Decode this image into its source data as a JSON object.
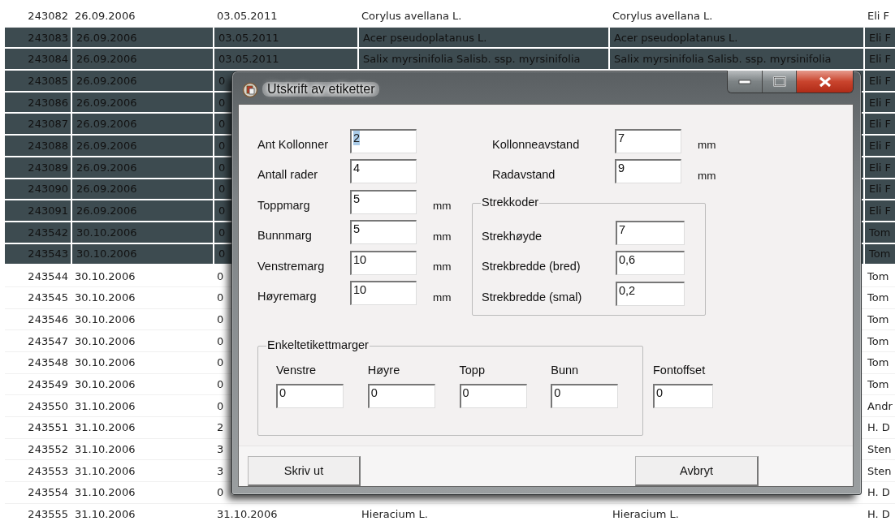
{
  "table": {
    "rows": [
      {
        "selected": false,
        "column_1": "243082",
        "column_2": "26.09.2006",
        "column_3": "03.05.2011",
        "column_4": "Corylus avellana L.",
        "column_5": "Corylus avellana L.",
        "column_6": "Eli F"
      },
      {
        "selected": true,
        "column_1": "243083",
        "column_2": "26.09.2006",
        "column_3": "03.05.2011",
        "column_4": "Acer pseudoplatanus L.",
        "column_5": "Acer pseudoplatanus L.",
        "column_6": "Eli F"
      },
      {
        "selected": true,
        "column_1": "243084",
        "column_2": "26.09.2006",
        "column_3": "03.05.2011",
        "column_4": "Salix myrsinifolia Salisb. ssp. myrsinifolia",
        "column_5": "Salix myrsinifolia Salisb. ssp. myrsinifolia",
        "column_6": "Eli F"
      },
      {
        "selected": true,
        "column_1": "243085",
        "column_2": "26.09.2006",
        "column_3": "0",
        "column_6": "Eli F"
      },
      {
        "selected": true,
        "column_1": "243086",
        "column_2": "26.09.2006",
        "column_3": "0",
        "column_6": "Eli F"
      },
      {
        "selected": true,
        "column_1": "243087",
        "column_2": "26.09.2006",
        "column_3": "0",
        "column_6": "Eli F"
      },
      {
        "selected": true,
        "column_1": "243088",
        "column_2": "26.09.2006",
        "column_3": "0",
        "column_6": "Eli F"
      },
      {
        "selected": true,
        "column_1": "243089",
        "column_2": "26.09.2006",
        "column_3": "0",
        "column_6": "Eli F"
      },
      {
        "selected": true,
        "column_1": "243090",
        "column_2": "26.09.2006",
        "column_3": "0",
        "column_6": "Eli F"
      },
      {
        "selected": true,
        "column_1": "243091",
        "column_2": "26.09.2006",
        "column_3": "0",
        "column_6": "Eli F"
      },
      {
        "selected": true,
        "column_1": "243542",
        "column_2": "30.10.2006",
        "column_3": "0",
        "column_6": "Tom"
      },
      {
        "selected": true,
        "column_1": "243543",
        "column_2": "30.10.2006",
        "column_3": "0",
        "column_6": "Tom"
      },
      {
        "selected": false,
        "column_1": "243544",
        "column_2": "30.10.2006",
        "column_3": "0",
        "column_6": "Tom"
      },
      {
        "selected": false,
        "column_1": "243545",
        "column_2": "30.10.2006",
        "column_3": "0",
        "column_6": "Tom"
      },
      {
        "selected": false,
        "column_1": "243546",
        "column_2": "30.10.2006",
        "column_3": "0",
        "column_6": "Tom"
      },
      {
        "selected": false,
        "column_1": "243547",
        "column_2": "30.10.2006",
        "column_3": "0",
        "column_6": "Tom"
      },
      {
        "selected": false,
        "column_1": "243548",
        "column_2": "30.10.2006",
        "column_3": "0",
        "column_6": "Tom"
      },
      {
        "selected": false,
        "column_1": "243549",
        "column_2": "30.10.2006",
        "column_3": "0",
        "column_6": "Tom"
      },
      {
        "selected": false,
        "column_1": "243550",
        "column_2": "31.10.2006",
        "column_3": "0",
        "column_6": "Andr"
      },
      {
        "selected": false,
        "column_1": "243551",
        "column_2": "31.10.2006",
        "column_3": "2",
        "column_6": "H. D"
      },
      {
        "selected": false,
        "column_1": "243552",
        "column_2": "31.10.2006",
        "column_3": "3",
        "column_6": "Sten"
      },
      {
        "selected": false,
        "column_1": "243553",
        "column_2": "31.10.2006",
        "column_3": "3",
        "column_6": "Sten"
      },
      {
        "selected": false,
        "column_1": "243554",
        "column_2": "31.10.2006",
        "column_3": "0",
        "column_6": "H. D"
      },
      {
        "selected": false,
        "column_1": "243555",
        "column_2": "31.10.2006",
        "column_3": "31.10.2006",
        "column_4": "Hieracium L.",
        "column_5": "Hieracium L.",
        "column_6": "H. D"
      }
    ]
  },
  "dialog": {
    "title": "Utskrift av etiketter",
    "left_fields": [
      {
        "label": "Ant Kollonner",
        "value": "2",
        "text_selected": true
      },
      {
        "label": "Antall rader",
        "value": "4",
        "text_selected": false
      },
      {
        "label": "Toppmarg",
        "value": "5",
        "unit": "mm",
        "text_selected": false
      },
      {
        "label": "Bunnmarg",
        "value": "5",
        "unit": "mm",
        "text_selected": false
      },
      {
        "label": "Venstremarg",
        "value": "10",
        "unit": "mm",
        "text_selected": false
      },
      {
        "label": "Høyremarg",
        "value": "10",
        "unit": "mm",
        "text_selected": false
      }
    ],
    "right_fields": [
      {
        "label": "Kollonneavstand",
        "value": "7",
        "unit": "mm"
      },
      {
        "label": "Radavstand",
        "value": "9",
        "unit": "mm"
      }
    ],
    "barcode_group": {
      "legend": "Strekkoder",
      "fields": [
        {
          "label": "Strekhøyde",
          "value": "7"
        },
        {
          "label": "Strekbredde (bred)",
          "value": "0,6"
        },
        {
          "label": "Strekbredde (smal)",
          "value": "0,2"
        }
      ]
    },
    "label_margins": {
      "legend": "Enkeltetikettmarger",
      "fields": [
        {
          "label": "Venstre",
          "value": "0"
        },
        {
          "label": "Høyre",
          "value": "0"
        },
        {
          "label": "Topp",
          "value": "0"
        },
        {
          "label": "Bunn",
          "value": "0"
        }
      ]
    },
    "font_offset": {
      "label": "Fontoffset",
      "value": "0"
    },
    "buttons": [
      {
        "label": "Skriv ut"
      },
      {
        "label": "Avbryt"
      }
    ]
  }
}
